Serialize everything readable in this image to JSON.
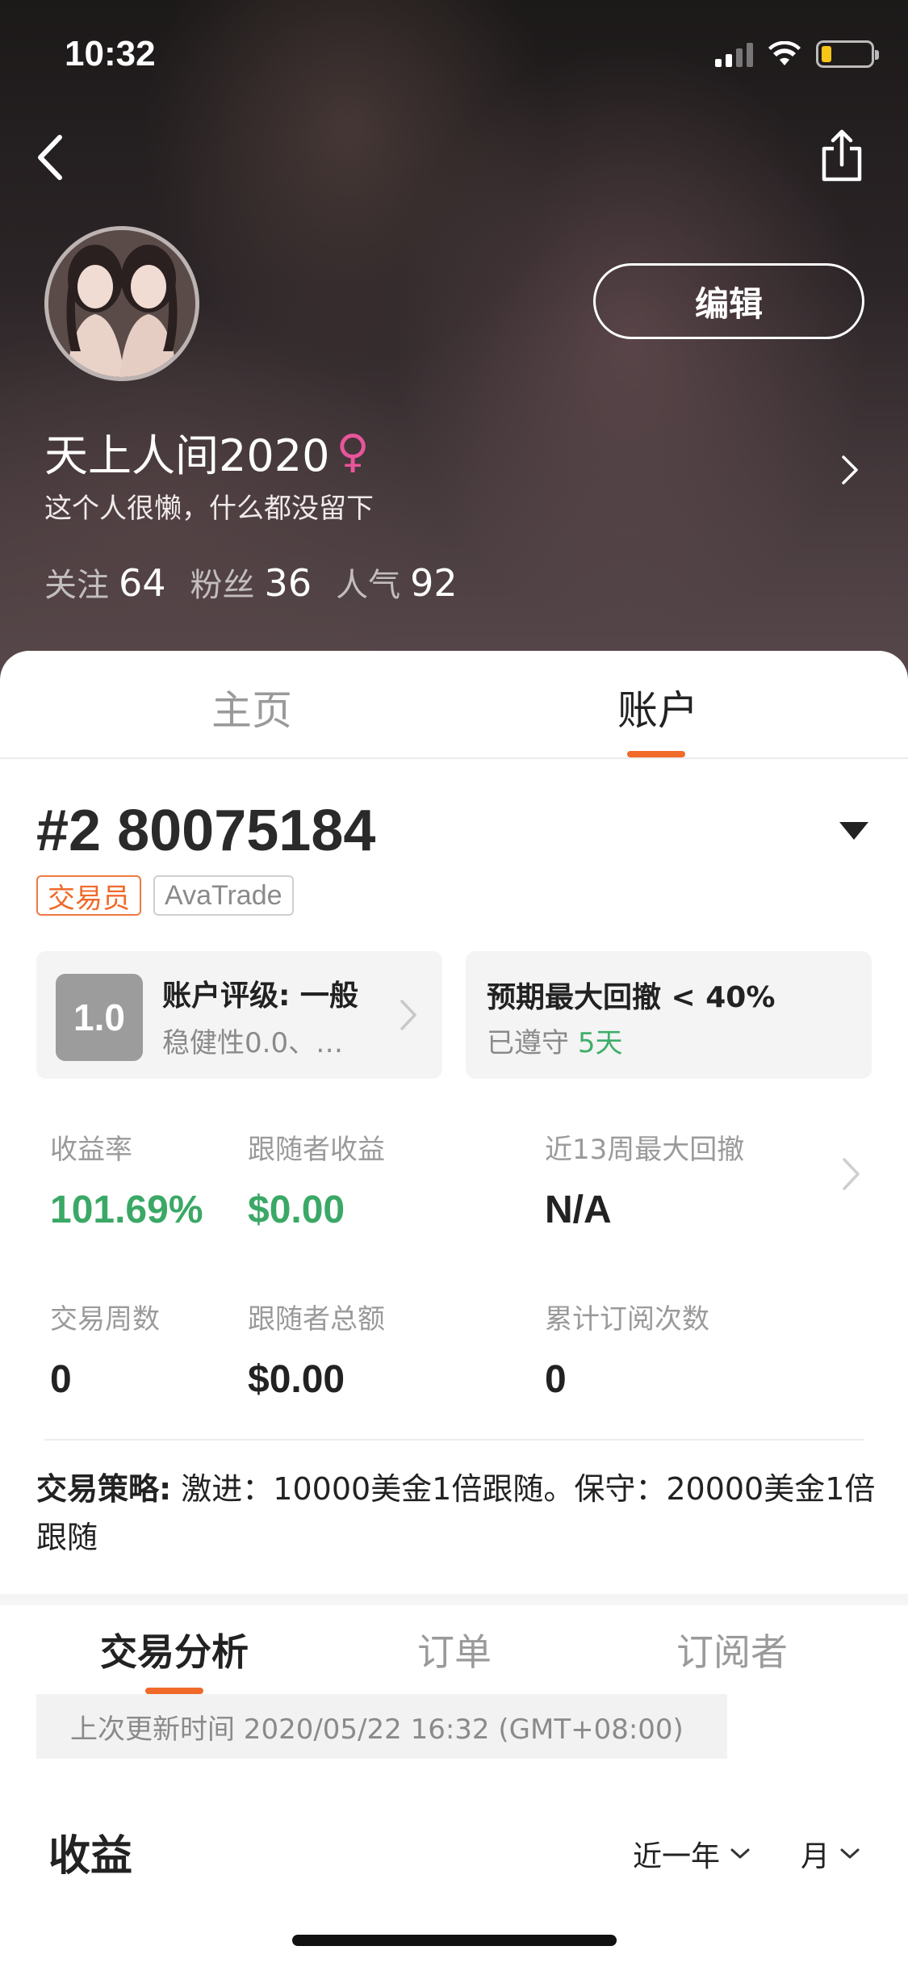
{
  "status_bar": {
    "time": "10:32"
  },
  "profile": {
    "name": "天上人间2020",
    "gender_symbol": "♀",
    "bio": "这个人很懒，什么都没留下",
    "edit_label": "编辑",
    "stats": [
      {
        "label": "关注",
        "value": "64"
      },
      {
        "label": "粉丝",
        "value": "36"
      },
      {
        "label": "人气",
        "value": "92"
      }
    ]
  },
  "top_tabs": [
    {
      "label": "主页",
      "active": false
    },
    {
      "label": "账户",
      "active": true
    }
  ],
  "account": {
    "id": "#2 80075184",
    "tags": [
      "交易员",
      "AvaTrade"
    ],
    "rating": {
      "score": "1.0",
      "title": "账户评级: 一般",
      "subtitle": "稳健性0.0、…"
    },
    "drawdown": {
      "title": "预期最大回撤 < 40%",
      "status": "已遵守",
      "days": "5天"
    }
  },
  "metrics": [
    {
      "label": "收益率",
      "value": "101.69%",
      "color": "#3ba866"
    },
    {
      "label": "跟随者收益",
      "value": "$0.00",
      "color": "#3ba866"
    },
    {
      "label": "近13周最大回撤",
      "value": "N/A",
      "color": "#222222"
    },
    {
      "label": "交易周数",
      "value": "0",
      "color": "#222222"
    },
    {
      "label": "跟随者总额",
      "value": "$0.00",
      "color": "#222222"
    },
    {
      "label": "累计订阅次数",
      "value": "0",
      "color": "#222222"
    }
  ],
  "strategy": {
    "label": "交易策略:",
    "text": " 激进：10000美金1倍跟随。保守：20000美金1倍跟随"
  },
  "sub_tabs": [
    {
      "label": "交易分析",
      "active": true
    },
    {
      "label": "订单",
      "active": false
    },
    {
      "label": "订阅者",
      "active": false
    }
  ],
  "update_time": "上次更新时间 2020/05/22 16:32 (GMT+08:00)",
  "earnings": {
    "title": "收益",
    "period_filter": "近一年",
    "unit_filter": "月"
  },
  "colors": {
    "accent": "#f06a2a",
    "positive": "#3ba866",
    "gender": "#e8559a"
  }
}
